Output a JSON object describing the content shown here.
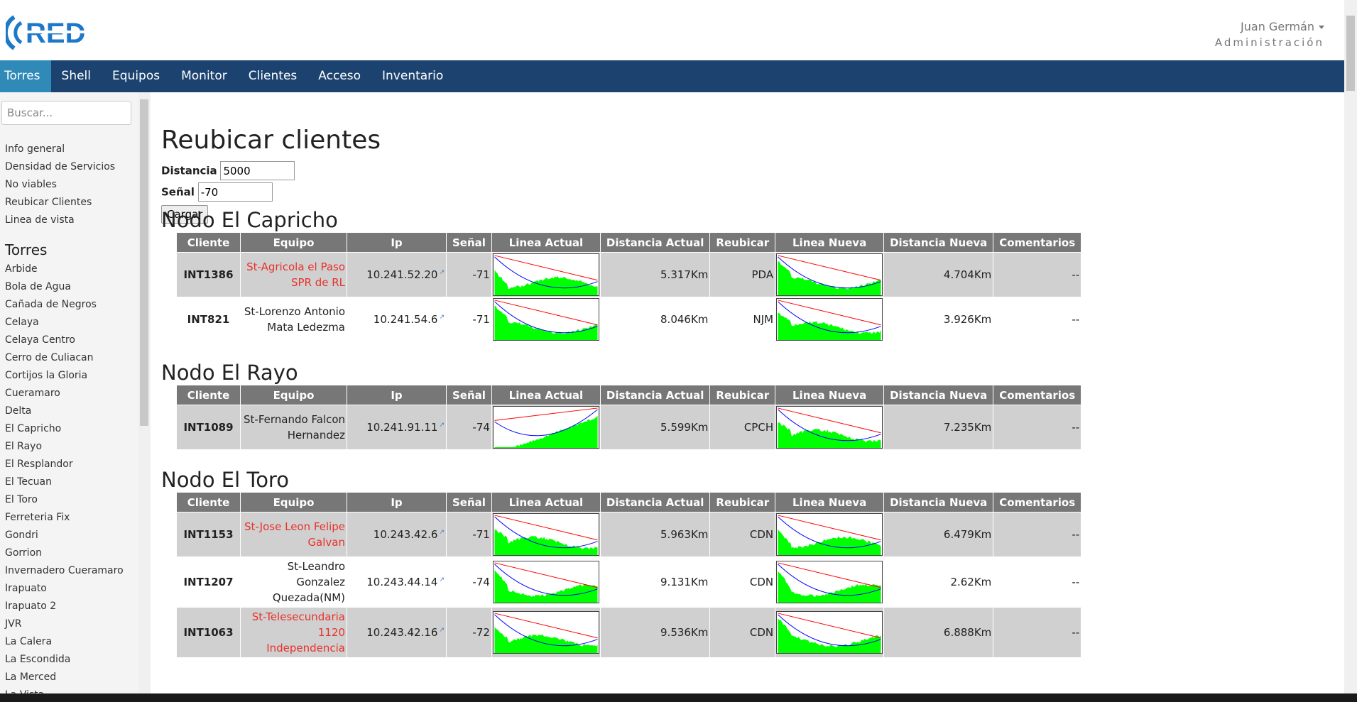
{
  "header": {
    "logo_text": "RED",
    "user_name": "Juan Germán",
    "user_role": "Administración"
  },
  "nav": [
    {
      "label": "Torres",
      "active": true
    },
    {
      "label": "Shell",
      "active": false
    },
    {
      "label": "Equipos",
      "active": false
    },
    {
      "label": "Monitor",
      "active": false
    },
    {
      "label": "Clientes",
      "active": false
    },
    {
      "label": "Acceso",
      "active": false
    },
    {
      "label": "Inventario",
      "active": false
    }
  ],
  "sidebar": {
    "search_placeholder": "Buscar...",
    "links": [
      "Info general",
      "Densidad de Servicios",
      "No viables",
      "Reubicar Clientes",
      "Linea de vista"
    ],
    "towers_heading": "Torres",
    "towers": [
      "Arbide",
      "Bola de Agua",
      "Cañada de Negros",
      "Celaya",
      "Celaya Centro",
      "Cerro de Culiacan",
      "Cortijos la Gloria",
      "Cueramaro",
      "Delta",
      "El Capricho",
      "El Rayo",
      "El Resplandor",
      "El Tecuan",
      "El Toro",
      "Ferreteria Fix",
      "Gondri",
      "Gorrion",
      "Invernadero Cueramaro",
      "Irapuato",
      "Irapuato 2",
      "JVR",
      "La Calera",
      "La Escondida",
      "La Merced",
      "La Vista"
    ]
  },
  "main": {
    "title": "Reubicar clientes",
    "distance_label": "Distancia",
    "distance_value": "5000",
    "signal_label": "Señal",
    "signal_value": "-70",
    "load_button": "Cargar",
    "columns": [
      "Cliente",
      "Equipo",
      "Ip",
      "Señal",
      "Linea Actual",
      "Distancia Actual",
      "Reubicar",
      "Linea Nueva",
      "Distancia Nueva",
      "Comentarios"
    ],
    "nodes": [
      {
        "title": "Nodo El Capricho",
        "rows": [
          {
            "cliente": "INT1386",
            "equipo": "St-Agricola el Paso SPR de RL",
            "equipo_red": true,
            "ip": "10.241.52.20",
            "senal": "-71",
            "dist_actual": "5.317Km",
            "reubicar": "PDA",
            "dist_nueva": "4.704Km",
            "comentarios": "--"
          },
          {
            "cliente": "INT821",
            "equipo": "St-Lorenzo Antonio Mata Ledezma",
            "equipo_red": false,
            "ip": "10.241.54.6",
            "senal": "-71",
            "dist_actual": "8.046Km",
            "reubicar": "NJM",
            "dist_nueva": "3.926Km",
            "comentarios": "--"
          }
        ]
      },
      {
        "title": "Nodo El Rayo",
        "rows": [
          {
            "cliente": "INT1089",
            "equipo": "St-Fernando Falcon Hernandez",
            "equipo_red": false,
            "ip": "10.241.91.11",
            "senal": "-74",
            "dist_actual": "5.599Km",
            "reubicar": "CPCH",
            "dist_nueva": "7.235Km",
            "comentarios": "--"
          }
        ]
      },
      {
        "title": "Nodo El Toro",
        "rows": [
          {
            "cliente": "INT1153",
            "equipo": "St-Jose Leon Felipe Galvan",
            "equipo_red": true,
            "ip": "10.243.42.6",
            "senal": "-71",
            "dist_actual": "5.963Km",
            "reubicar": "CDN",
            "dist_nueva": "6.479Km",
            "comentarios": "--"
          },
          {
            "cliente": "INT1207",
            "equipo": "St-Leandro Gonzalez Quezada(NM)",
            "equipo_red": false,
            "ip": "10.243.44.14",
            "senal": "-74",
            "dist_actual": "9.131Km",
            "reubicar": "CDN",
            "dist_nueva": "2.62Km",
            "comentarios": "--"
          },
          {
            "cliente": "INT1063",
            "equipo": "St-Telesecundaria 1120 Independencia",
            "equipo_red": true,
            "ip": "10.243.42.16",
            "senal": "-72",
            "dist_actual": "9.536Km",
            "reubicar": "CDN",
            "dist_nueva": "6.888Km",
            "comentarios": "--"
          }
        ]
      }
    ]
  },
  "colors": {
    "navbar": "#1c4370",
    "nav_active": "#2f8ab8",
    "table_header": "#777777",
    "row_shade": "#d0d0d0",
    "red_text": "#e8312a",
    "terrain": "#00ff00",
    "los_line": "#ff0000",
    "fresnel_line": "#0000ff"
  }
}
